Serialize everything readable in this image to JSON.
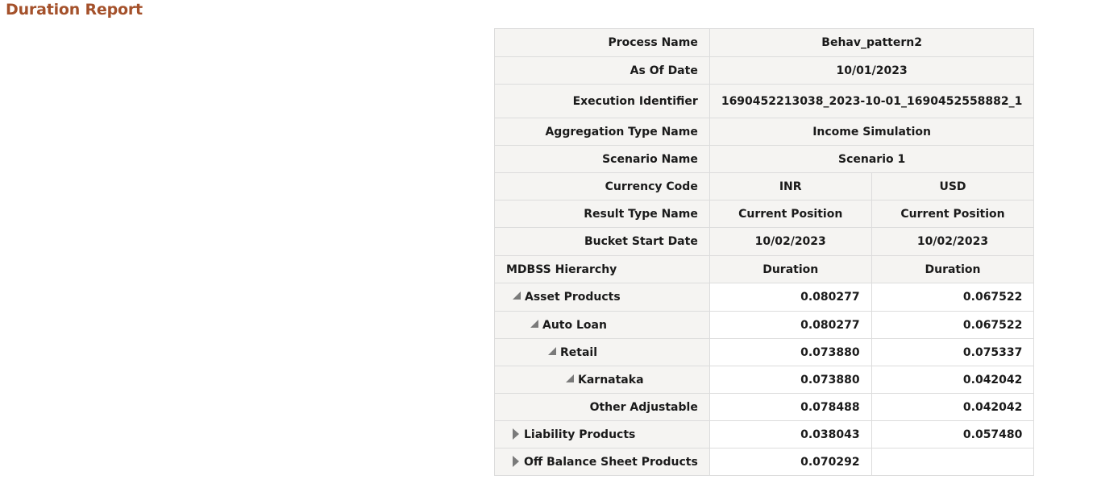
{
  "report": {
    "title": "Duration Report"
  },
  "header": {
    "process_name_label": "Process Name",
    "process_name_value": "Behav_pattern2",
    "as_of_date_label": "As Of Date",
    "as_of_date_value": "10/01/2023",
    "execution_identifier_label": "Execution Identifier",
    "execution_identifier_value": "1690452213038_2023-10-01_1690452558882_1",
    "aggregation_type_label": "Aggregation Type Name",
    "aggregation_type_value": "Income Simulation",
    "scenario_name_label": "Scenario Name",
    "scenario_name_value": "Scenario 1",
    "currency_code_label": "Currency Code",
    "currency_codes": [
      "INR",
      "USD"
    ],
    "result_type_label": "Result Type Name",
    "result_types": [
      "Current Position",
      "Current Position"
    ],
    "bucket_start_date_label": "Bucket Start Date",
    "bucket_start_dates": [
      "10/02/2023",
      "10/02/2023"
    ],
    "hierarchy_label": "MDBSS Hierarchy",
    "measures": [
      "Duration",
      "Duration"
    ]
  },
  "rows": [
    {
      "label": "Asset Products",
      "values": [
        "0.080277",
        "0.067522"
      ],
      "state": "expanded"
    },
    {
      "label": "Auto Loan",
      "values": [
        "0.080277",
        "0.067522"
      ],
      "state": "expanded"
    },
    {
      "label": "Retail",
      "values": [
        "0.073880",
        "0.075337"
      ],
      "state": "expanded"
    },
    {
      "label": "Karnataka",
      "values": [
        "0.073880",
        "0.042042"
      ],
      "state": "expanded"
    },
    {
      "label": "Other Adjustable",
      "values": [
        "0.078488",
        "0.042042"
      ],
      "state": "leaf"
    },
    {
      "label": "Liability Products",
      "values": [
        "0.038043",
        "0.057480"
      ],
      "state": "collapsed"
    },
    {
      "label": "Off Balance Sheet Products",
      "values": [
        "0.070292",
        ""
      ],
      "state": "collapsed"
    }
  ],
  "icons": {
    "expanded": "collapse-triangle-icon",
    "collapsed": "expand-triangle-icon"
  }
}
